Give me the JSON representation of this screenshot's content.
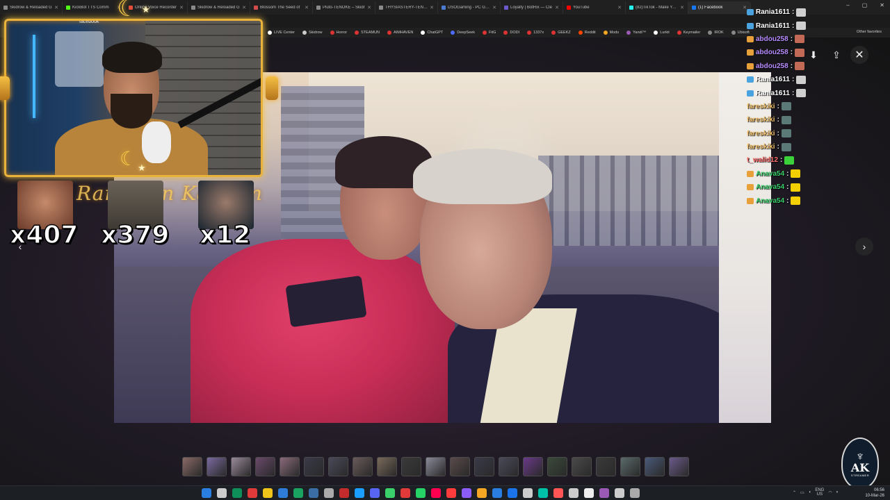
{
  "browser": {
    "tabs": [
      {
        "label": "Skidrow & Reloaded G",
        "color": "#8a8a8a",
        "active": false
      },
      {
        "label": "KickBot TTS Comm",
        "color": "#53fc18",
        "active": false
      },
      {
        "label": "Online Voice Recorder",
        "color": "#e44d3a",
        "active": false
      },
      {
        "label": "Skidrow & Reloaded G",
        "color": "#8a8a8a",
        "active": false
      },
      {
        "label": "Blossom The Seed of",
        "color": "#d34c4c",
        "active": false
      },
      {
        "label": "Pluto-TENOKE – Skidr",
        "color": "#8a8a8a",
        "active": false
      },
      {
        "label": "THYSIASTERY-TENOKE",
        "color": "#8a8a8a",
        "active": false
      },
      {
        "label": "DSOGaming - PC Gam",
        "color": "#4a7bd0",
        "active": false
      },
      {
        "label": "Loyalty | BotRix — Cle",
        "color": "#6a5acd",
        "active": false
      },
      {
        "label": "YouTube",
        "color": "#ff0000",
        "active": false
      },
      {
        "label": "(82)TikTok - Make Your",
        "color": "#25f4ee",
        "active": false
      },
      {
        "label": "(1) Facebook",
        "color": "#1877f2",
        "active": true
      }
    ],
    "window_controls": [
      "–",
      "▢",
      "✕"
    ],
    "bookmarks": [
      {
        "label": "LIVE Center",
        "color": "#ffffff"
      },
      {
        "label": "Skidrow",
        "color": "#cccccc"
      },
      {
        "label": "Horror",
        "color": "#d33"
      },
      {
        "label": "STEAMUN",
        "color": "#d33"
      },
      {
        "label": "AIMHAVEN",
        "color": "#d33"
      },
      {
        "label": "ChatGPT",
        "color": "#ffffff"
      },
      {
        "label": "DeepSeek",
        "color": "#4d6bfe"
      },
      {
        "label": "FitG",
        "color": "#d33"
      },
      {
        "label": "DODI",
        "color": "#d33"
      },
      {
        "label": "1337x",
        "color": "#d33"
      },
      {
        "label": "GEEKZ",
        "color": "#d33"
      },
      {
        "label": "Reddit",
        "color": "#ff4500"
      },
      {
        "label": "Mods",
        "color": "#f5a623"
      },
      {
        "label": "Yandi™",
        "color": "#9b59b6"
      },
      {
        "label": "Lurkit",
        "color": "#ffffff"
      },
      {
        "label": "Keymailer",
        "color": "#d33"
      },
      {
        "label": "IROK",
        "color": "#888"
      },
      {
        "label": "Ubisoft",
        "color": "#888"
      }
    ],
    "other_favorites": "Other favorites",
    "facebook_label": "facebook"
  },
  "overlay": {
    "banner_text": "Ramadan Kareem",
    "reactions": [
      {
        "count": "x407",
        "color": "#7a4a3a"
      },
      {
        "count": "x379",
        "color": "#3e3a33"
      },
      {
        "count": "x12",
        "color": "#2a3b48"
      }
    ]
  },
  "chat": {
    "top_notification": "Instagram - Messages",
    "messages": [
      {
        "user": "Rania1611",
        "color": "#ffffff",
        "badge": "#4aa3df",
        "emote": "#cfcfcf"
      },
      {
        "user": "Rania1611",
        "color": "#ffffff",
        "badge": "#4aa3df",
        "emote": "#cfcfcf"
      },
      {
        "user": "abdou258",
        "color": "#b88cff",
        "badge": "#e8a03a",
        "emote": "#c26a56"
      },
      {
        "user": "abdou258",
        "color": "#b88cff",
        "badge": "#e8a03a",
        "emote": "#c26a56"
      },
      {
        "user": "abdou258",
        "color": "#b88cff",
        "badge": "#e8a03a",
        "emote": "#c26a56"
      },
      {
        "user": "Rania1611",
        "color": "#ffffff",
        "badge": "#4aa3df",
        "emote": "#cfcfcf"
      },
      {
        "user": "Rania1611",
        "color": "#ffffff",
        "badge": "#4aa3df",
        "emote": "#cfcfcf"
      },
      {
        "user": "fareskiki",
        "color": "#f5c26b",
        "badge": "",
        "emote": "#5b7a77"
      },
      {
        "user": "fareskiki",
        "color": "#f5c26b",
        "badge": "",
        "emote": "#5b7a77"
      },
      {
        "user": "fareskiki",
        "color": "#f5c26b",
        "badge": "",
        "emote": "#5b7a77"
      },
      {
        "user": "fareskiki",
        "color": "#f5c26b",
        "badge": "",
        "emote": "#5b7a77"
      },
      {
        "user": "t_walid12",
        "color": "#ff6b6b",
        "badge": "",
        "emote": "#3ad13a"
      },
      {
        "user": "Anava54",
        "color": "#3ad16b",
        "badge": "#e8a03a",
        "emote": "#f5d000"
      },
      {
        "user": "Anava54",
        "color": "#3ad16b",
        "badge": "#e8a03a",
        "emote": "#f5d000"
      },
      {
        "user": "Anava54",
        "color": "#3ad16b",
        "badge": "#e8a03a",
        "emote": "#f5d000"
      }
    ]
  },
  "viewer": {
    "download_icon": "download-icon",
    "share_icon": "share-icon",
    "close_icon": "close-icon",
    "next_icon": "chevron-right-icon",
    "prev_icon": "chevron-left-icon"
  },
  "thumbnails": [
    "#8a6a66",
    "#7a6aa0",
    "#9a8a9a",
    "#6a4a6a",
    "#8a6a7a",
    "#3a3a4a",
    "#4a4a5a",
    "#6a5a5a",
    "#7a6a5a",
    "#3a3a3a",
    "#8a8a9a",
    "#5a4a4a",
    "#3a3a4a",
    "#4a4a5a",
    "#6a3a8a",
    "#3a4a3a",
    "#4a4a4a",
    "#3a3a3a",
    "#5a6a6a",
    "#4a5a7a",
    "#6a5a8a"
  ],
  "logo": {
    "title": "AK",
    "subtitle": "STREAMER"
  },
  "taskbar": {
    "icons": [
      "#2a7de1",
      "#cccccc",
      "#0e8f5a",
      "#e03a3a",
      "#f0c419",
      "#2f7bd8",
      "#1aa260",
      "#3a6ea5",
      "#aaaaaa",
      "#c42b2b",
      "#1a9fff",
      "#5865f2",
      "#3ad16b",
      "#e03a3a",
      "#25d366",
      "#ff0050",
      "#ff3b3b",
      "#8b5cf6",
      "#f5a623",
      "#2a7de1",
      "#1a73e8",
      "#cccccc",
      "#00c2a8",
      "#ff5555",
      "#cccccc",
      "#eeeeee",
      "#9b59b6",
      "#cccccc",
      "#aaaaaa"
    ],
    "lang_top": "ENG",
    "lang_bottom": "US",
    "time": "06:56",
    "date": "10-Mar-26"
  }
}
